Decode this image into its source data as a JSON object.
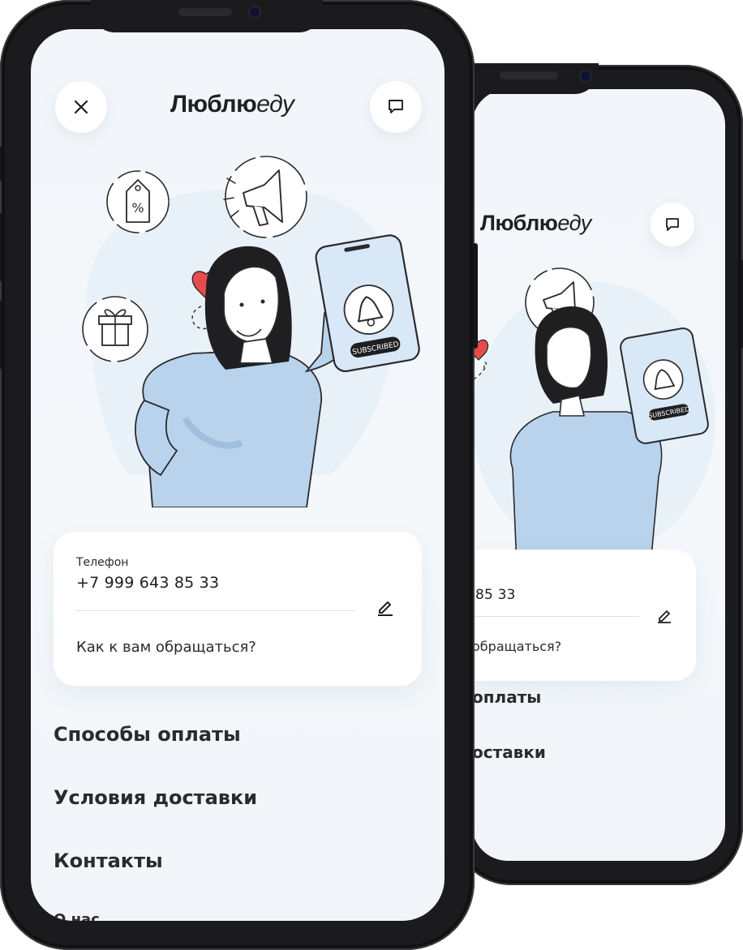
{
  "app": {
    "logo_bold": "Люблю",
    "logo_light": "еду"
  },
  "illustration": {
    "badge_text": "SUBSCRIBED",
    "tag_text": "%"
  },
  "profile_card": {
    "phone_label": "Телефон",
    "phone_value": "+7 999 643 85 33",
    "name_placeholder": "Как к вам обращаться?"
  },
  "menu": {
    "items": [
      {
        "label": "Способы оплаты"
      },
      {
        "label": "Условия доставки"
      },
      {
        "label": "Контакты"
      },
      {
        "label": "О нас"
      }
    ]
  },
  "back_phone": {
    "phone_value_fragment": "85 33",
    "name_placeholder_fragment": "обращаться?",
    "menu_fragment_1": "оплаты",
    "menu_fragment_2": "оставки"
  },
  "colors": {
    "screen_bg": "#f2f6fa",
    "illustration_blue": "#b9d3ec",
    "heart": "#e74c4c",
    "text_dark": "#2b2b2f"
  },
  "icons": [
    "close-icon",
    "chat-icon",
    "edit-icon",
    "bell-icon",
    "megaphone-icon",
    "gift-icon",
    "discount-tag-icon",
    "heart-icon"
  ]
}
